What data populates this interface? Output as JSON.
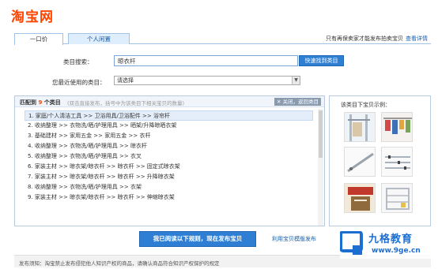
{
  "logo": {
    "text": "淘宝网"
  },
  "tabs": [
    {
      "label": "一口价"
    },
    {
      "label": "个人闲置"
    }
  ],
  "auth_hint": {
    "text": "只有再保卖家才能发布拍卖宝贝",
    "link": "查看详情"
  },
  "search": {
    "label": "类目搜索：",
    "value": "晾衣杆",
    "button": "快速找到类目"
  },
  "recent": {
    "label": "您最近使用的类目：",
    "selected": "请选择"
  },
  "results": {
    "match_prefix": "匹配到",
    "match_count": "9",
    "match_suffix": "个类目",
    "note": "(双击直接发布，括号中为该类目下相关宝贝的数量)",
    "close_button": "关闭，返回类目",
    "items": [
      "1.  家庭/个人清洁工具 >> 卫浴用具/卫浴配件 >> 浴帘杆",
      "2.  收纳整理 >> 衣物洗/晒/护理用具 >> 晒架/升降晾晒衣架",
      "3.  基础建材 >> 家用五金 >> 家用五金 >> 衣杆",
      "4.  收纳整理 >> 衣物洗/晒/护理用具 >> 晾衣杆",
      "5.  收纳整理 >> 衣物洗/晒/护理用具 >> 衣叉",
      "6.  家装主材 >> 晾衣架/晾衣杆 >> 晾衣杆 >> 固定式晾衣架",
      "7.  家装主材 >> 晾衣架/晾衣杆 >> 晾衣杆 >> 升降晾衣架",
      "8.  收纳整理 >> 衣物洗/晒/护理用具 >> 衣架",
      "9.  家装主材 >> 晾衣架/晾衣杆 >> 晾衣杆 >> 伸缩晾衣架"
    ]
  },
  "preview": {
    "title": "该类目下宝贝示例："
  },
  "publish_button": "我已阅读以下规则，现在发布宝贝",
  "template_link": "利用宝贝模版发布",
  "footer": {
    "text": "发布须知：淘宝禁止发布侵犯他人知识产权的商品，请确认商品符合知识产权保护的规定"
  },
  "watermark": {
    "name": "九格教育",
    "url": "www.9ge.cn"
  },
  "colors": {
    "brand": "#ff4400",
    "accent": "#2e7fd4",
    "link": "#1a5fa8"
  }
}
